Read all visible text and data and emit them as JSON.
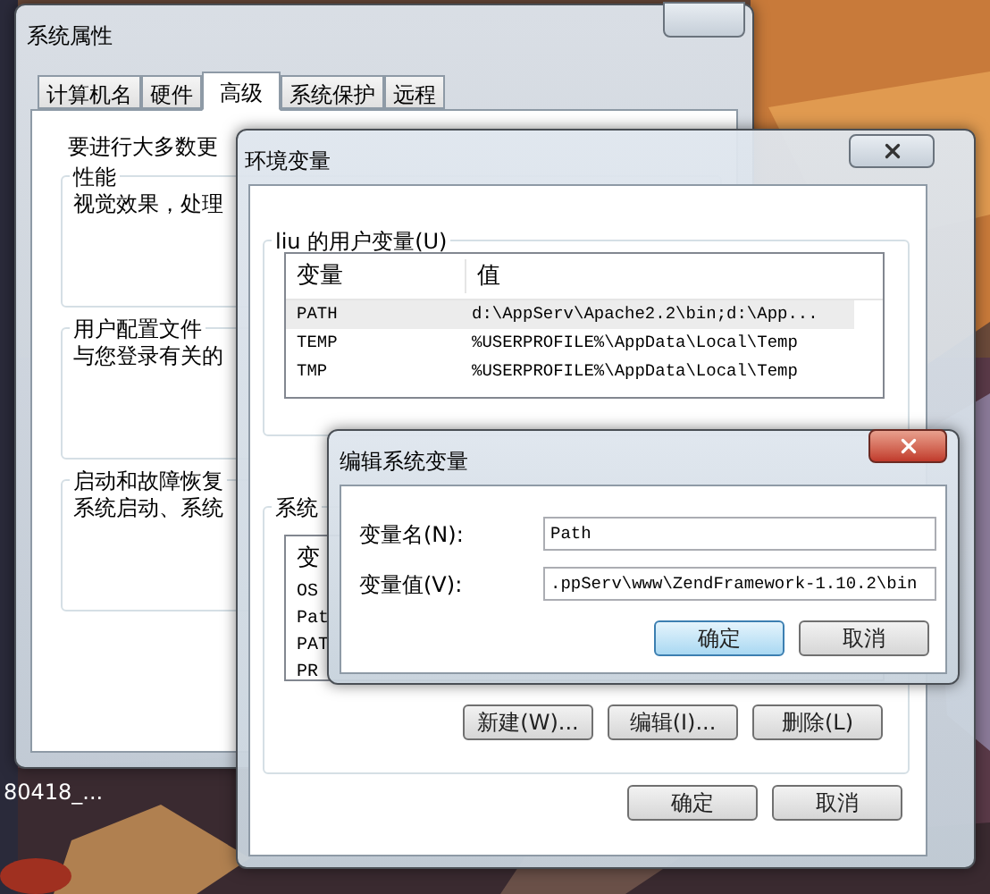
{
  "desktop": {
    "icon_label": "80418_..."
  },
  "system_properties": {
    "title": "系统属性",
    "tabs": [
      {
        "label": "计算机名",
        "selected": false
      },
      {
        "label": "硬件",
        "selected": false
      },
      {
        "label": "高级",
        "selected": true
      },
      {
        "label": "系统保护",
        "selected": false
      },
      {
        "label": "远程",
        "selected": false
      }
    ],
    "intro": "要进行大多数更",
    "groups": [
      {
        "title": "性能",
        "text": "视觉效果，处理"
      },
      {
        "title": "用户配置文件",
        "text": "与您登录有关的"
      },
      {
        "title": "启动和故障恢复",
        "text": "系统启动、系统"
      }
    ]
  },
  "environment_variables": {
    "title": "环境变量",
    "user_group_title": "liu 的用户变量(U)",
    "user_columns": [
      "变量",
      "值"
    ],
    "user_rows": [
      {
        "name": "PATH",
        "value": "d:\\AppServ\\Apache2.2\\bin;d:\\App...",
        "selected": true
      },
      {
        "name": "TEMP",
        "value": "%USERPROFILE%\\AppData\\Local\\Temp",
        "selected": false
      },
      {
        "name": "TMP",
        "value": "%USERPROFILE%\\AppData\\Local\\Temp",
        "selected": false
      }
    ],
    "system_group_title": "系统",
    "system_column": "变",
    "system_rows": [
      "OS",
      "Pat",
      "PAT",
      "PR"
    ],
    "system_buttons": [
      "新建(W)...",
      "编辑(I)...",
      "删除(L)"
    ],
    "buttons": [
      "确定",
      "取消"
    ]
  },
  "edit_dialog": {
    "title": "编辑系统变量",
    "fields": [
      {
        "label": "变量名(N):",
        "value": "Path"
      },
      {
        "label": "变量值(V):",
        "value": ".ppServ\\www\\ZendFramework-1.10.2\\bin"
      }
    ],
    "buttons": [
      {
        "label": "确定",
        "default": true
      },
      {
        "label": "取消",
        "default": false
      }
    ]
  }
}
